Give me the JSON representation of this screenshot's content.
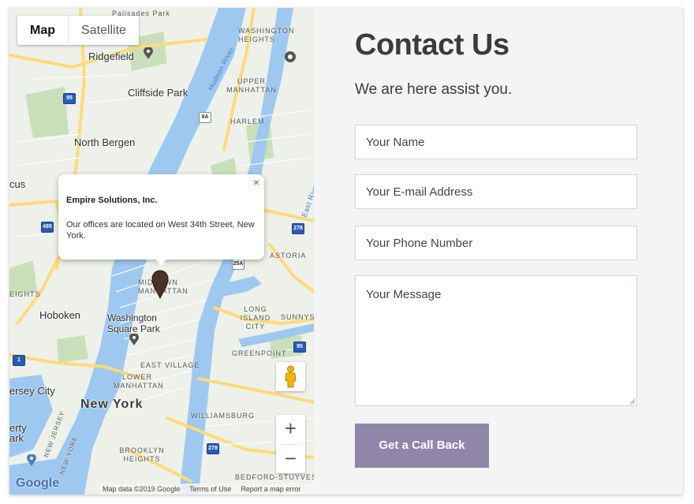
{
  "map": {
    "type_controls": {
      "map_label": "Map",
      "satellite_label": "Satellite"
    },
    "info_window": {
      "title": "Empire Solutions, Inc.",
      "body": "Our offices are located on West 34th Street, New York.",
      "close_glyph": "×"
    },
    "labels": {
      "palisades_park": "Palisades Park",
      "washington_heights": "WASHINGTON HEIGHTS",
      "ridgefield": "Ridgefield",
      "cliffside_park": "Cliffside Park",
      "hudson_river": "Hudson River",
      "upper_manhattan": "UPPER MANHATTAN",
      "harlem": "HARLEM",
      "north_bergen": "North Bergen",
      "secaucus": "cus",
      "midtown_manhattan": "MIDTOWN MANHATTAN",
      "astoria": "ASTORIA",
      "heights": "EIGHTS",
      "hoboken": "Hoboken",
      "long_island_city": "LONG ISLAND CITY",
      "sunnyside": "SUNNYS",
      "washington_square_park": "Washington Square Park",
      "greenpoint": "GREENPOINT",
      "east_village": "EAST VILLAGE",
      "jersey_city": "ersey City",
      "lower_manhattan": "LOWER MANHATTAN",
      "new_york": "New York",
      "williamsburg": "WILLIAMSBURG",
      "liberty": "erty",
      "park": "ark",
      "brooklyn_heights": "BROOKLYN HEIGHTS",
      "new_jersey": "NEW JERSEY",
      "new_york_state": "NEW YORK",
      "bedford_stuyvesant": "BEDFORD-STUYVESANT",
      "east_river": "East River"
    },
    "shields": [
      "95",
      "9A",
      "495",
      "278",
      "25A",
      "1",
      "9A",
      "278",
      "95"
    ],
    "zoom": {
      "in": "+",
      "out": "−"
    },
    "google_logo": "Google",
    "attribution": {
      "data": "Map data ©2019 Google",
      "terms": "Terms of Use",
      "report": "Report a map error"
    },
    "colors": {
      "water": "#9ec8f0",
      "highway": "#fcdb7a",
      "park": "#c9dfba",
      "land": "#eef0ea"
    }
  },
  "form": {
    "heading": "Contact Us",
    "subheading": "We are here assist you.",
    "fields": {
      "name": "Your Name",
      "email": "Your E-mail Address",
      "phone": "Your Phone Number",
      "message": "Your Message"
    },
    "submit_label": "Get a Call Back",
    "colors": {
      "button": "#8f86a9",
      "heading": "#3e3a38",
      "field_border": "#cfd8c9"
    }
  }
}
